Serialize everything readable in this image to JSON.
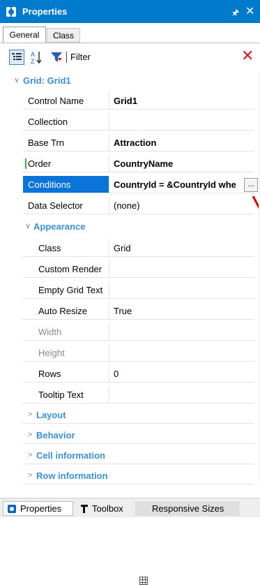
{
  "panel": {
    "title": "Properties",
    "pin_icon": "pin-icon",
    "close_icon": "close-icon"
  },
  "tabs": [
    {
      "label": "General",
      "active": true
    },
    {
      "label": "Class",
      "active": false
    }
  ],
  "toolbar": {
    "filter_label": "Filter",
    "filter_value": "",
    "clear_icon": "clear-filter-icon"
  },
  "grid": {
    "group_title": "Grid: Grid1",
    "properties": [
      {
        "name": "Control Name",
        "value": "Grid1"
      },
      {
        "name": "Collection",
        "value": ""
      },
      {
        "name": "Base Trn",
        "value": "Attraction"
      },
      {
        "name": "Order",
        "value": "CountryName"
      },
      {
        "name": "Conditions",
        "value": "CountryId = &CountryId whe",
        "edit_button": "..."
      },
      {
        "name": "Data Selector",
        "value": "(none)"
      }
    ],
    "appearance": {
      "title": "Appearance",
      "properties": [
        {
          "name": "Class",
          "value": "Grid"
        },
        {
          "name": "Custom Render",
          "value": ""
        },
        {
          "name": "Empty Grid Text",
          "value": ""
        },
        {
          "name": "Auto Resize",
          "value": "True"
        },
        {
          "name": "Width",
          "value": ""
        },
        {
          "name": "Height",
          "value": ""
        },
        {
          "name": "Rows",
          "value": "0"
        },
        {
          "name": "Tooltip Text",
          "value": ""
        }
      ]
    },
    "collapsed_sections": [
      "Layout",
      "Behavior",
      "Cell information",
      "Row information"
    ]
  },
  "bottom_tabs": [
    {
      "label": "Properties",
      "icon": "properties-icon",
      "active": true
    },
    {
      "label": "Toolbox",
      "icon": "toolbox-icon",
      "active": false
    },
    {
      "label": "Responsive Sizes",
      "icon": "responsive-grid-icon",
      "active": false
    }
  ],
  "colors": {
    "accent": "#007acc",
    "selection": "#0a74da",
    "section_text": "#3c8fd6",
    "clear": "#e81123"
  }
}
